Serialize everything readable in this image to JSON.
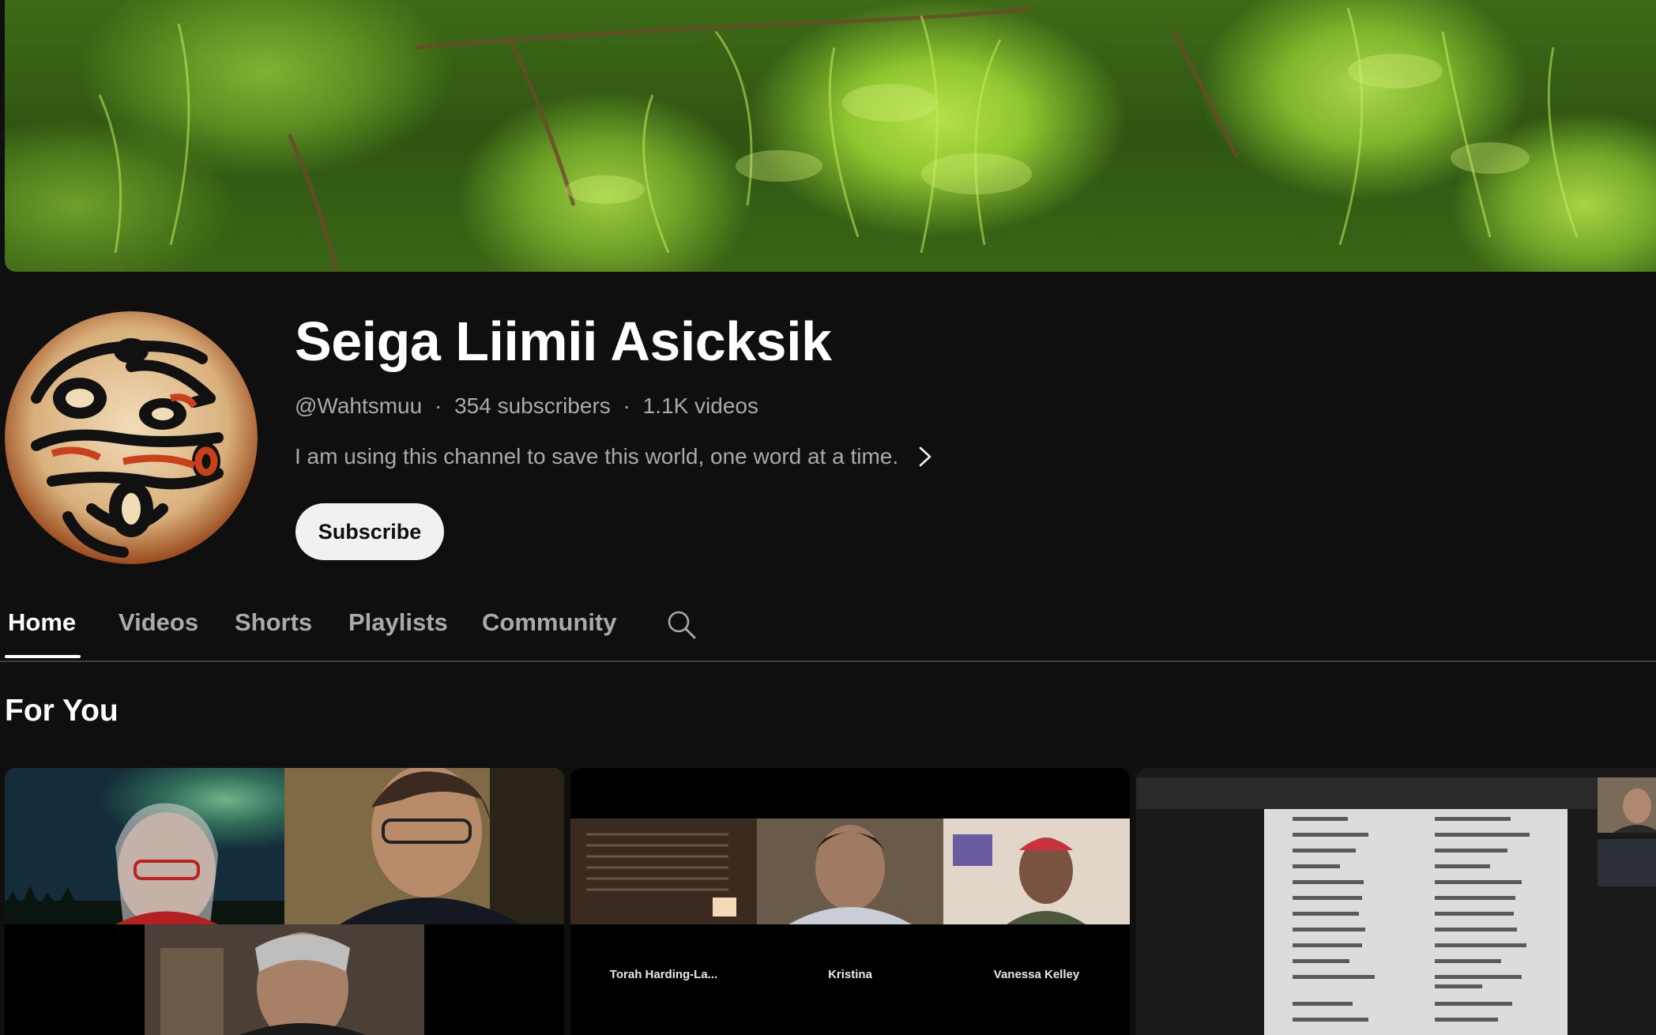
{
  "channel": {
    "name": "Seiga Liimii Asicksik",
    "handle": "@Wahtsmuu",
    "subscribers": "354 subscribers",
    "videos": "1.1K videos",
    "separator": "·",
    "description": "I am using this channel to save this world, one word at a time.",
    "subscribe_label": "Subscribe"
  },
  "tabs": [
    {
      "label": "Home",
      "active": true
    },
    {
      "label": "Videos",
      "active": false
    },
    {
      "label": "Shorts",
      "active": false
    },
    {
      "label": "Playlists",
      "active": false
    },
    {
      "label": "Community",
      "active": false
    }
  ],
  "section": {
    "title": "For You"
  },
  "videos": [
    {
      "participants": []
    },
    {
      "participants": [
        "Torah  Harding-La...",
        "Kristina",
        "Vanessa Kelley"
      ]
    },
    {
      "participants": []
    }
  ],
  "icons": {
    "description_more": "chevron-right-icon",
    "tab_search": "search-icon"
  },
  "colors": {
    "background": "#0f0f0f",
    "primary_text": "#f1f1f1",
    "secondary_text": "#aaaaaa",
    "subscribe_bg": "#f1f1f1"
  }
}
